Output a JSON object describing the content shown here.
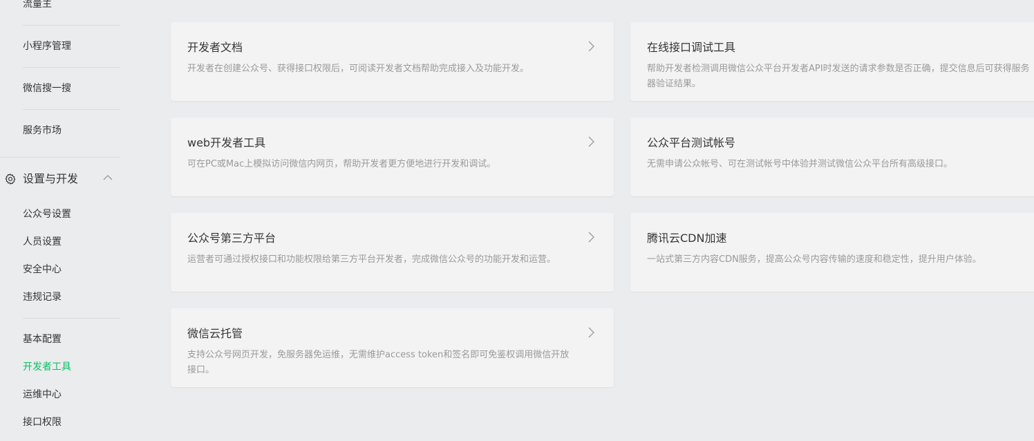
{
  "sidebar": {
    "items_top": [
      {
        "label": "流量主"
      },
      {
        "label": "小程序管理"
      },
      {
        "label": "微信搜一搜"
      },
      {
        "label": "服务市场"
      }
    ],
    "group": {
      "label": "设置与开发",
      "icon": "gear-icon",
      "expanded": true
    },
    "items_settings": [
      {
        "label": "公众号设置"
      },
      {
        "label": "人员设置"
      },
      {
        "label": "安全中心"
      },
      {
        "label": "违规记录"
      }
    ],
    "items_dev": [
      {
        "label": "基本配置",
        "active": false
      },
      {
        "label": "开发者工具",
        "active": true
      },
      {
        "label": "运维中心",
        "active": false
      },
      {
        "label": "接口权限",
        "active": false
      }
    ],
    "active_color": "#07c160"
  },
  "cards": [
    {
      "title": "开发者文档",
      "desc": "开发者在创建公众号、获得接口权限后，可阅读开发者文档帮助完成接入及功能开发。"
    },
    {
      "title": "在线接口调试工具",
      "desc": "帮助开发者检测调用微信公众平台开发者API时发送的请求参数是否正确，提交信息后可获得服务器验证结果。"
    },
    {
      "title": "web开发者工具",
      "desc": "可在PC或Mac上模拟访问微信内网页，帮助开发者更方便地进行开发和调试。"
    },
    {
      "title": "公众平台测试帐号",
      "desc": "无需申请公众帐号、可在测试帐号中体验并测试微信公众平台所有高级接口。"
    },
    {
      "title": "公众号第三方平台",
      "desc": "运营者可通过授权接口和功能权限给第三方平台开发者，完成微信公众号的功能开发和运营。"
    },
    {
      "title": "腾讯云CDN加速",
      "desc": "一站式第三方内容CDN服务，提高公众号内容传输的速度和稳定性，提升用户体验。"
    },
    {
      "title": "微信云托管",
      "desc": "支持公众号网页开发，免服务器免运维，无需维护access token和签名即可免鉴权调用微信开放接口。"
    }
  ]
}
